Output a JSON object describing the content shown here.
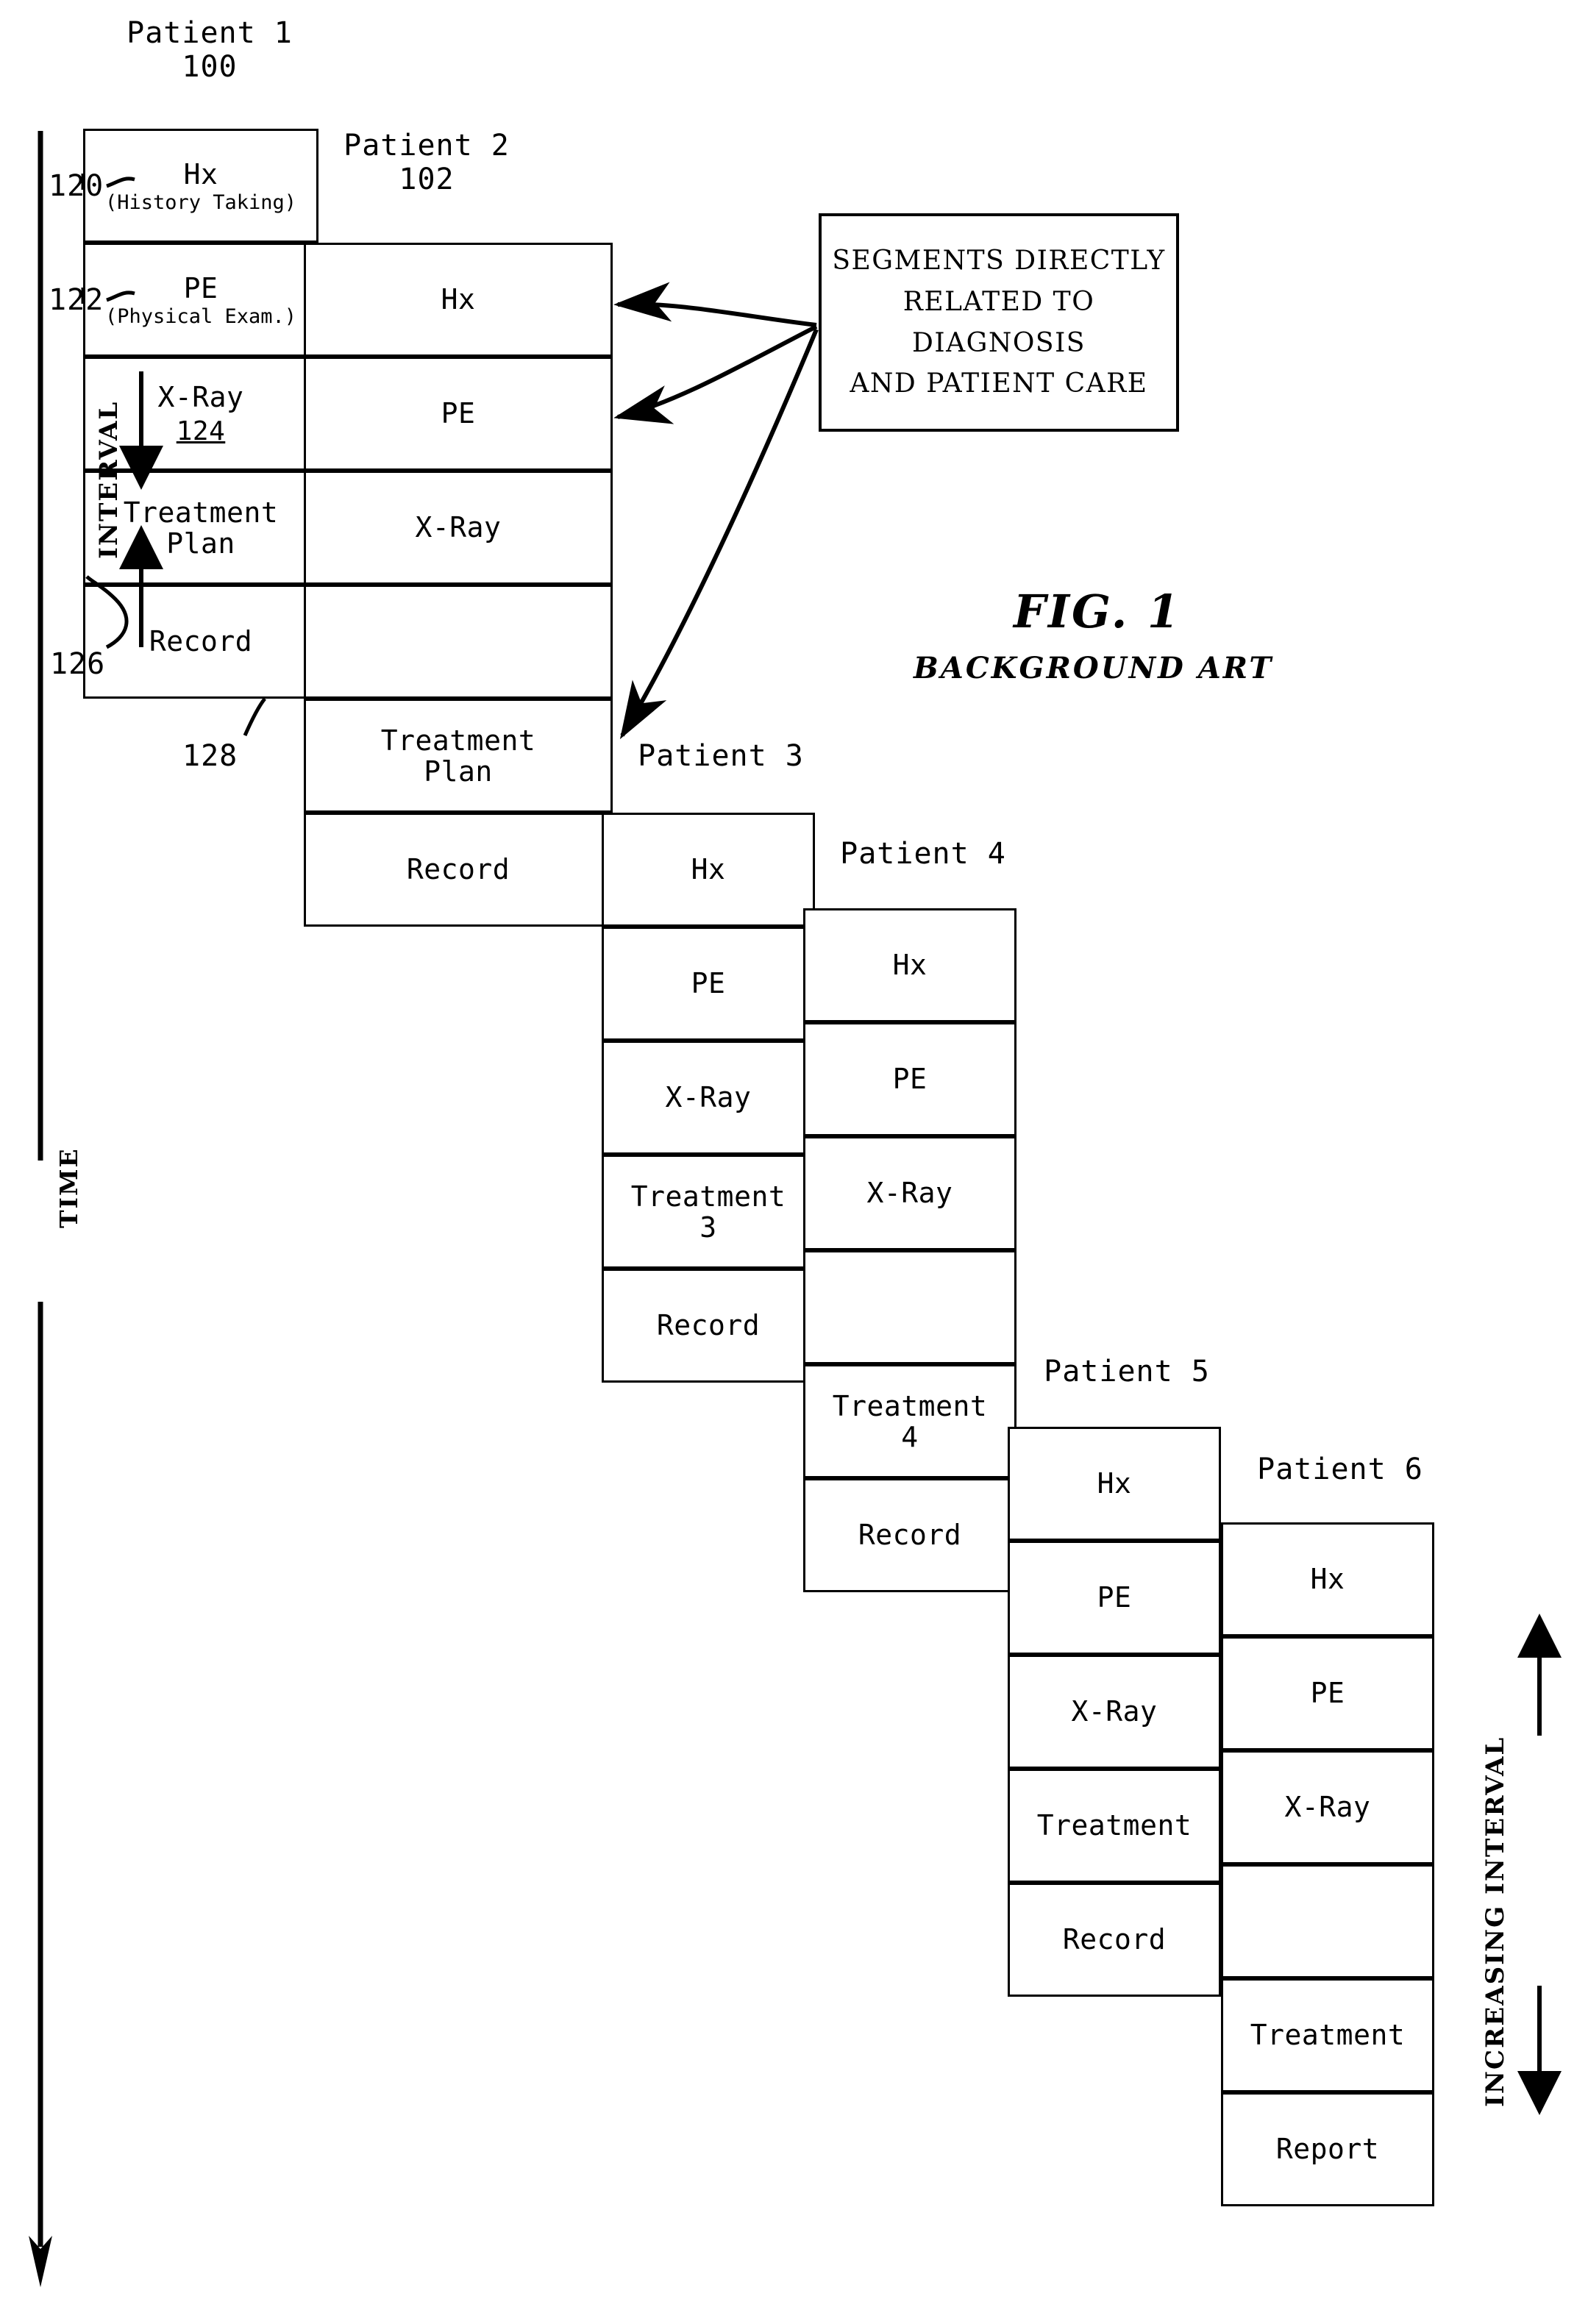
{
  "figure": {
    "title": "FIG. 1",
    "subtitle": "BACKGROUND ART"
  },
  "axes": {
    "time_label": "TIME",
    "interval_label": "INTERVAL",
    "increasing_interval_label": "INCREASING INTERVAL"
  },
  "callout": {
    "line1": "SEGMENTS DIRECTLY",
    "line2": "RELATED TO DIAGNOSIS",
    "line3": "AND PATIENT CARE"
  },
  "reference_numbers": {
    "ref_120": "120",
    "ref_122": "122",
    "ref_124": "124",
    "ref_126": "126",
    "ref_128": "128"
  },
  "columns": [
    {
      "title": "Patient 1",
      "number": "100",
      "cells": [
        {
          "label": "Hx",
          "sub": "(History Taking)"
        },
        {
          "label": "PE",
          "sub": "(Physical Exam.)"
        },
        {
          "label": "X-Ray",
          "refnum": "124"
        },
        {
          "label": "Treatment",
          "label2": "Plan"
        },
        {
          "label": "Record"
        }
      ]
    },
    {
      "title": "Patient 2",
      "number": "102",
      "cells": [
        {
          "label": "Hx"
        },
        {
          "label": "PE"
        },
        {
          "label": "X-Ray"
        },
        {
          "label": ""
        },
        {
          "label": "Treatment",
          "label2": "Plan"
        },
        {
          "label": "Record"
        }
      ]
    },
    {
      "title": "Patient 3",
      "number": "",
      "cells": [
        {
          "label": "Hx"
        },
        {
          "label": "PE"
        },
        {
          "label": "X-Ray"
        },
        {
          "label": "Treatment",
          "label2": "3"
        },
        {
          "label": "Record"
        }
      ]
    },
    {
      "title": "Patient 4",
      "number": "",
      "cells": [
        {
          "label": "Hx"
        },
        {
          "label": "PE"
        },
        {
          "label": "X-Ray"
        },
        {
          "label": ""
        },
        {
          "label": "Treatment",
          "label2": "4"
        },
        {
          "label": "Record"
        }
      ]
    },
    {
      "title": "Patient 5",
      "number": "",
      "cells": [
        {
          "label": "Hx"
        },
        {
          "label": "PE"
        },
        {
          "label": "X-Ray"
        },
        {
          "label": "Treatment"
        },
        {
          "label": "Record"
        }
      ]
    },
    {
      "title": "Patient 6",
      "number": "",
      "cells": [
        {
          "label": "Hx"
        },
        {
          "label": "PE"
        },
        {
          "label": "X-Ray"
        },
        {
          "label": ""
        },
        {
          "label": "Treatment"
        },
        {
          "label": "Report"
        }
      ]
    }
  ],
  "colors": {
    "ink": "#000000",
    "paper": "#ffffff"
  }
}
